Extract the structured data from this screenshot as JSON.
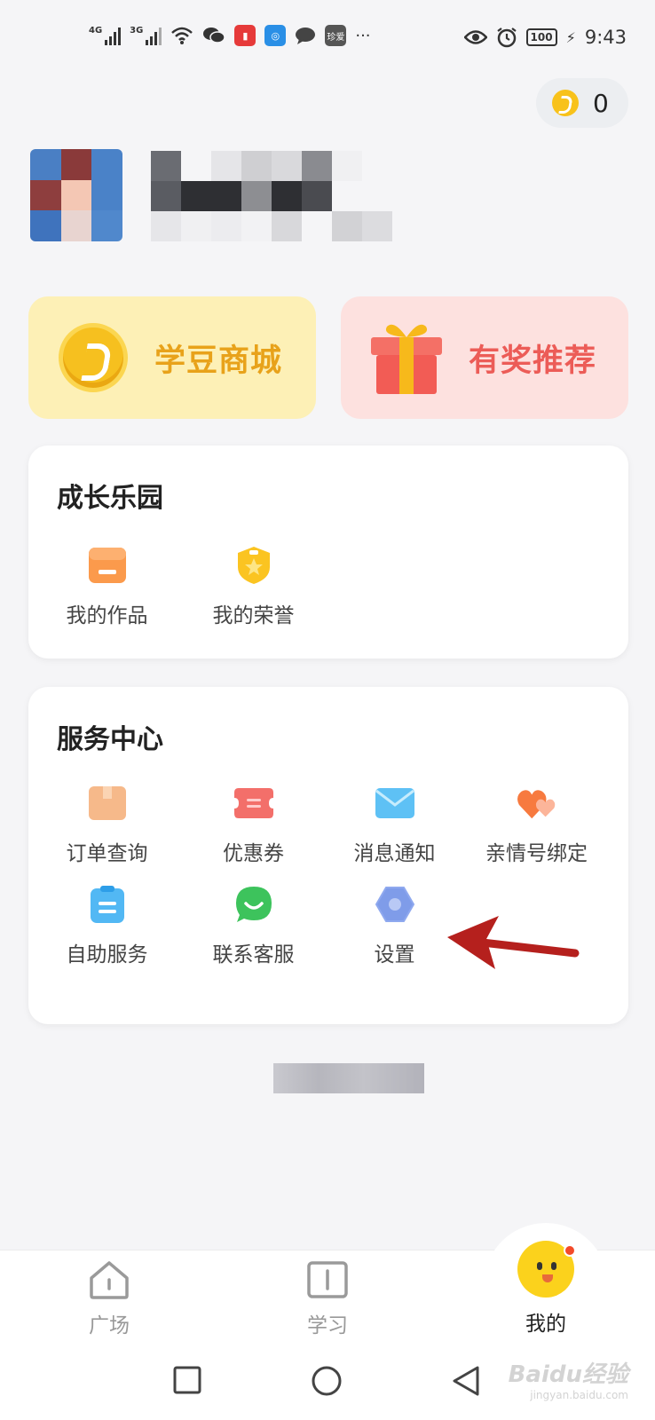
{
  "status_bar": {
    "network_1": "4G",
    "network_2": "3G",
    "app_badge": "珍爱",
    "more": "···",
    "battery": "100",
    "time": "9:43"
  },
  "coins": {
    "count": "0"
  },
  "promo": {
    "mall_label": "学豆商城",
    "referral_label": "有奖推荐"
  },
  "growth": {
    "title": "成长乐园",
    "items": [
      {
        "label": "我的作品",
        "icon": "works-icon"
      },
      {
        "label": "我的荣誉",
        "icon": "honor-icon"
      }
    ]
  },
  "service": {
    "title": "服务中心",
    "items": [
      {
        "label": "订单查询",
        "icon": "order-box-icon"
      },
      {
        "label": "优惠券",
        "icon": "coupon-icon"
      },
      {
        "label": "消息通知",
        "icon": "mail-icon"
      },
      {
        "label": "亲情号绑定",
        "icon": "hearts-icon"
      },
      {
        "label": "自助服务",
        "icon": "clipboard-icon"
      },
      {
        "label": "联系客服",
        "icon": "chat-bubble-icon"
      },
      {
        "label": "设置",
        "icon": "settings-hex-icon"
      }
    ]
  },
  "bottom_nav": {
    "items": [
      {
        "label": "广场",
        "icon": "home-icon"
      },
      {
        "label": "学习",
        "icon": "book-icon"
      },
      {
        "label": "我的",
        "icon": "mascot-icon",
        "active": true
      }
    ]
  },
  "watermark": {
    "brand": "Baidu经验",
    "url": "jingyan.baidu.com"
  },
  "colors": {
    "mall_bg": "#fdf0b6",
    "mall_text": "#e8a21a",
    "referral_bg": "#fde1df",
    "referral_text": "#ec5c57",
    "annotation_arrow": "#b5201d"
  }
}
